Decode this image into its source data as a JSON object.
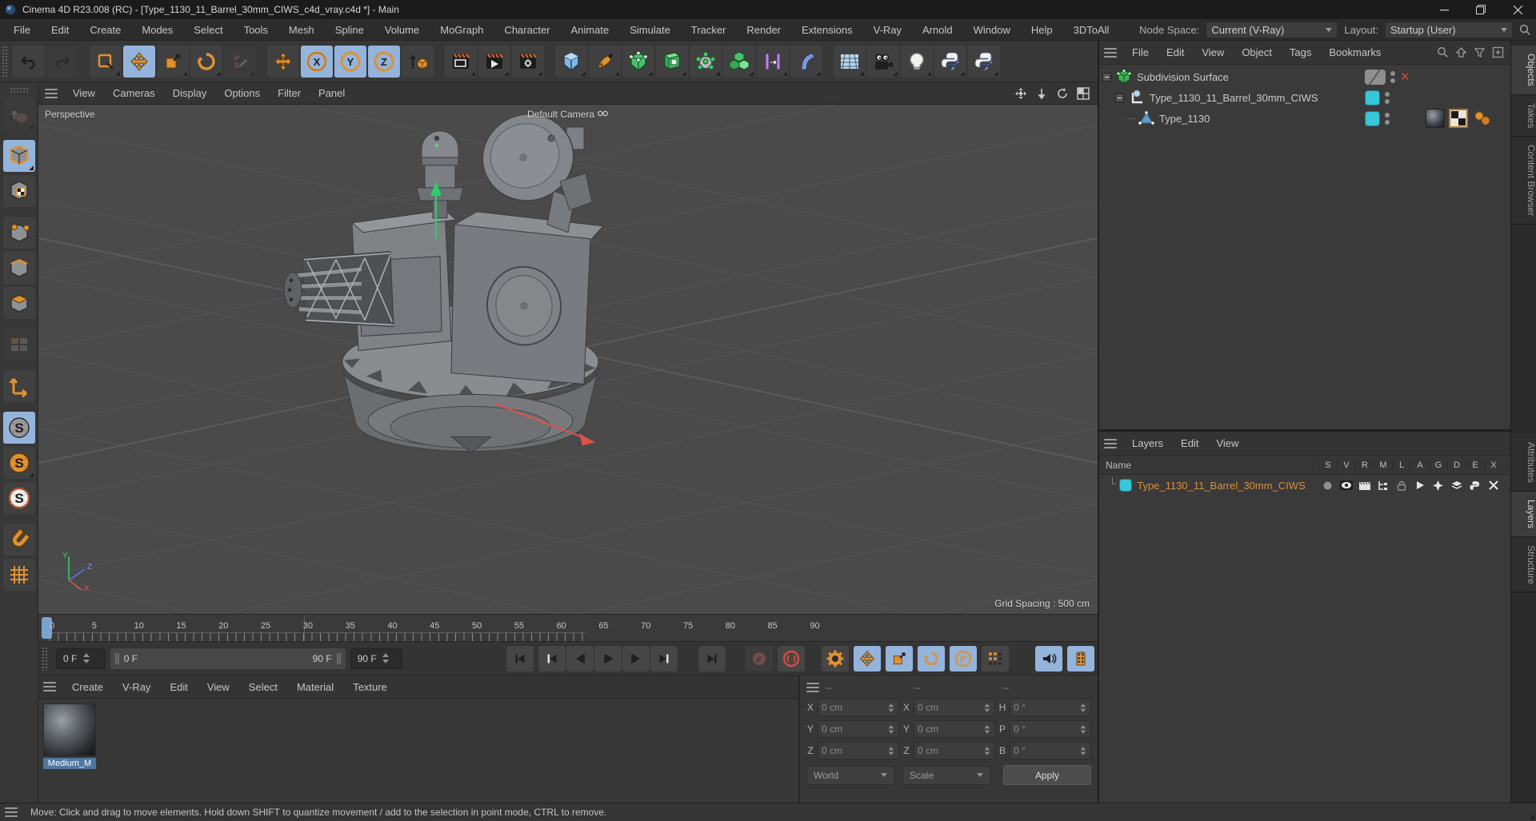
{
  "window": {
    "title": "Cinema 4D R23.008 (RC) - [Type_1130_11_Barrel_30mm_CIWS_c4d_vray.c4d *] - Main",
    "controls": [
      "minimize",
      "maximize",
      "close"
    ]
  },
  "menu_bar": {
    "items": [
      "File",
      "Edit",
      "Create",
      "Modes",
      "Select",
      "Tools",
      "Mesh",
      "Spline",
      "Volume",
      "MoGraph",
      "Character",
      "Animate",
      "Simulate",
      "Tracker",
      "Render",
      "Extensions",
      "V-Ray",
      "Arnold",
      "Window",
      "Help",
      "3DToAll"
    ],
    "node_space_label": "Node Space:",
    "node_space_value": "Current (V-Ray)",
    "layout_label": "Layout:",
    "layout_value": "Startup (User)"
  },
  "toolbar": {
    "icons": [
      "undo-icon",
      "redo-icon",
      "rectangle-select-icon",
      "move-tool-icon",
      "scale-tool-icon",
      "rotate-tool-icon",
      "last-tool-icon",
      "move-axis-icon",
      "x-axis-lock",
      "y-axis-lock",
      "z-axis-lock",
      "coordinate-system-icon",
      "render-view-icon",
      "render-picture-viewer-icon",
      "render-settings-icon",
      "cube-primitive-icon",
      "pen-spline-icon",
      "subdivision-surface-icon",
      "generator-icon",
      "cloner-icon",
      "volume-icon",
      "character-rig-icon",
      "bend-deformer-icon",
      "workplane-icon",
      "stage-camera-icon",
      "light-icon",
      "python-icon",
      "python-icon"
    ],
    "axis_locks": [
      "X",
      "Y",
      "Z"
    ]
  },
  "left_palette": {
    "icons": [
      "make-editable-icon",
      "model-mode-icon",
      "texture-mode-icon",
      "point-mode-icon",
      "edge-mode-icon",
      "polygon-mode-icon",
      "workplane-mode-icon",
      "axis-mode-icon",
      "enable-snap-icon",
      "snap-3d-icon",
      "snap-settings-icon",
      "magnet-icon",
      "quantize-icon"
    ],
    "snap_letter": "S"
  },
  "viewport": {
    "menu": [
      "View",
      "Cameras",
      "Display",
      "Options",
      "Filter",
      "Panel"
    ],
    "view_label": "Perspective",
    "camera_label": "Default Camera",
    "grid_spacing": "Grid Spacing : 500 cm",
    "axis": {
      "x": "X",
      "y": "Y",
      "z": "Z"
    }
  },
  "object_manager": {
    "menu": [
      "File",
      "Edit",
      "View",
      "Object",
      "Tags",
      "Bookmarks"
    ],
    "header_icons": [
      "search-icon",
      "up-icon",
      "filter-icon",
      "add-panel-icon"
    ],
    "side_tabs": [
      "Objects",
      "Takes",
      "Content Browser"
    ],
    "tree": [
      {
        "label": "Subdivision Surface",
        "icon": "subdivision-surface-object-icon"
      },
      {
        "label": "Type_1130_11_Barrel_30mm_CIWS",
        "icon": "null-object-icon"
      },
      {
        "label": "Type_1130",
        "icon": "polygon-object-icon",
        "tags": [
          "material-tag",
          "uvw-tag",
          "phong-tag"
        ]
      }
    ]
  },
  "layers_panel": {
    "menu": [
      "Layers",
      "Edit",
      "View"
    ],
    "name_header": "Name",
    "columns": [
      "S",
      "V",
      "R",
      "M",
      "L",
      "A",
      "G",
      "D",
      "E",
      "X"
    ],
    "side_tabs": [
      "Attributes",
      "Layers",
      "Structure"
    ],
    "rows": [
      {
        "name": "Type_1130_11_Barrel_30mm_CIWS",
        "color": "#38c6d9"
      }
    ]
  },
  "timeline": {
    "tick_labels": [
      "0",
      "5",
      "10",
      "15",
      "20",
      "25",
      "30",
      "35",
      "40",
      "45",
      "50",
      "55",
      "60",
      "65",
      "70",
      "75",
      "80",
      "85",
      "90"
    ],
    "current_frame": "0 F",
    "range_start": "0 F",
    "range_end": "90 F",
    "end_frame": "90 F",
    "transport_icons": [
      "goto-start-icon",
      "prev-key-icon",
      "prev-frame-icon",
      "play-icon",
      "next-frame-icon",
      "next-key-icon",
      "goto-end-icon",
      "record-keyframe-icon",
      "autokey-icon",
      "keying-settings-icon",
      "key-position-icon",
      "key-scale-icon",
      "key-rotation-icon",
      "key-parameter-icon",
      "key-pla-icon",
      "sound-icon",
      "playback-render-icon"
    ],
    "parameter_letter": "P"
  },
  "material_manager": {
    "menu": [
      "Create",
      "V-Ray",
      "Edit",
      "View",
      "Select",
      "Material",
      "Texture"
    ],
    "materials": [
      {
        "name": "Medium_M"
      }
    ]
  },
  "coordinates": {
    "header_dashes": [
      "--",
      "--",
      "--"
    ],
    "position": [
      {
        "label": "X",
        "value": "0 cm"
      },
      {
        "label": "Y",
        "value": "0 cm"
      },
      {
        "label": "Z",
        "value": "0 cm"
      }
    ],
    "size": [
      {
        "label": "X",
        "value": "0 cm"
      },
      {
        "label": "Y",
        "value": "0 cm"
      },
      {
        "label": "Z",
        "value": "0 cm"
      }
    ],
    "rotation": [
      {
        "label": "H",
        "value": "0 °"
      },
      {
        "label": "P",
        "value": "0 °"
      },
      {
        "label": "B",
        "value": "0 °"
      }
    ],
    "world_dropdown": "World",
    "scale_dropdown": "Scale",
    "apply_button": "Apply"
  },
  "status_bar": {
    "text": "Move: Click and drag to move elements. Hold down SHIFT to quantize movement / add to the selection in point mode, CTRL to remove."
  },
  "colors": {
    "accent": "#e0912f",
    "blue": "#94b4dc",
    "cyan": "#38c6d9",
    "selorange": "#d78f3c",
    "red": "#d84b42",
    "axgreen": "#33cc70",
    "axred": "#e05149",
    "selbg": "#50779f"
  }
}
